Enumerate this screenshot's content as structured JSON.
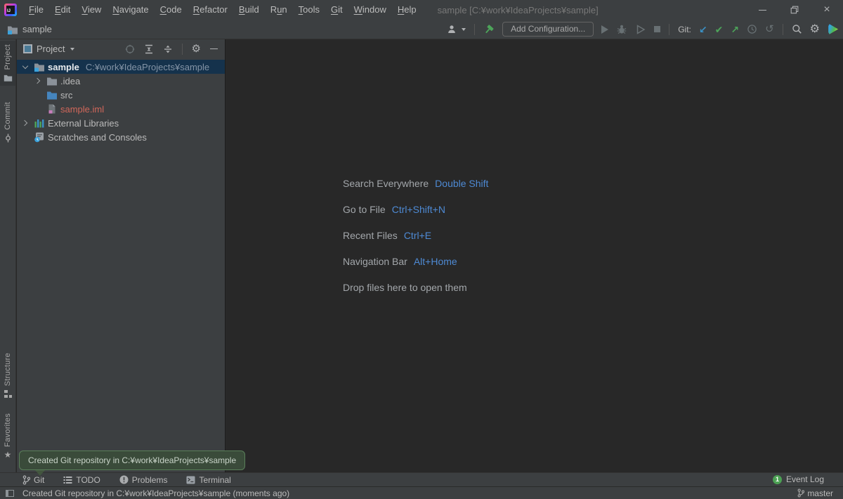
{
  "colors": {
    "selection": "#15324C",
    "accent_blue": "#3B92C6",
    "green": "#4DA45A",
    "red_file": "#D1675A",
    "shortcut_key_blue": "#4E8AD4",
    "balloon_bg": "#3A4B3A",
    "balloon_border": "#5A7F5A",
    "badge_green": "#4CA154"
  },
  "icons": {
    "minimize": "–",
    "close": "×",
    "gear": "⚙",
    "commit_check": "✔",
    "update_arrow": "↙",
    "push_arrow": "↗",
    "rollback": "↺",
    "star": "★",
    "logo_text": "IJ"
  },
  "title_bar": {
    "title": "sample [C:¥work¥IdeaProjects¥sample]",
    "menus": [
      {
        "pre": "",
        "mn": "F",
        "post": "ile"
      },
      {
        "pre": "",
        "mn": "E",
        "post": "dit"
      },
      {
        "pre": "",
        "mn": "V",
        "post": "iew"
      },
      {
        "pre": "",
        "mn": "N",
        "post": "avigate"
      },
      {
        "pre": "",
        "mn": "C",
        "post": "ode"
      },
      {
        "pre": "",
        "mn": "R",
        "post": "efactor"
      },
      {
        "pre": "",
        "mn": "B",
        "post": "uild"
      },
      {
        "pre": "R",
        "mn": "u",
        "post": "n"
      },
      {
        "pre": "",
        "mn": "T",
        "post": "ools"
      },
      {
        "pre": "",
        "mn": "G",
        "post": "it"
      },
      {
        "pre": "",
        "mn": "W",
        "post": "indow"
      },
      {
        "pre": "",
        "mn": "H",
        "post": "elp"
      }
    ]
  },
  "toolbar": {
    "project_name": "sample",
    "add_configuration": "Add Configuration...",
    "git_label": "Git:"
  },
  "stripe": {
    "top": [
      {
        "label": "Project"
      },
      {
        "label": "Commit"
      }
    ],
    "bottom": [
      {
        "label": "Structure"
      },
      {
        "label": "Favorites"
      }
    ]
  },
  "project_panel": {
    "header_label": "Project",
    "tree": [
      {
        "name": "sample",
        "path": "C:¥work¥IdeaProjects¥sample"
      },
      {
        "name": ".idea"
      },
      {
        "name": "src"
      },
      {
        "name": "sample.iml"
      },
      {
        "name": "External Libraries"
      },
      {
        "name": "Scratches and Consoles"
      }
    ]
  },
  "editor": {
    "shortcuts": [
      {
        "label": "Search Everywhere",
        "key": "Double Shift"
      },
      {
        "label": "Go to File",
        "key": "Ctrl+Shift+N"
      },
      {
        "label": "Recent Files",
        "key": "Ctrl+E"
      },
      {
        "label": "Navigation Bar",
        "key": "Alt+Home"
      },
      {
        "label": "Drop files here to open them",
        "key": ""
      }
    ]
  },
  "notification": {
    "text": "Created Git repository in C:¥work¥IdeaProjects¥sample"
  },
  "bottom_bar": {
    "tabs": [
      {
        "label": "Git"
      },
      {
        "label": "TODO"
      },
      {
        "label": "Problems"
      },
      {
        "label": "Terminal"
      }
    ],
    "event_log": "Event Log",
    "event_count": "1"
  },
  "status_bar": {
    "message": "Created Git repository in C:¥work¥IdeaProjects¥sample (moments ago)",
    "branch": "master"
  }
}
